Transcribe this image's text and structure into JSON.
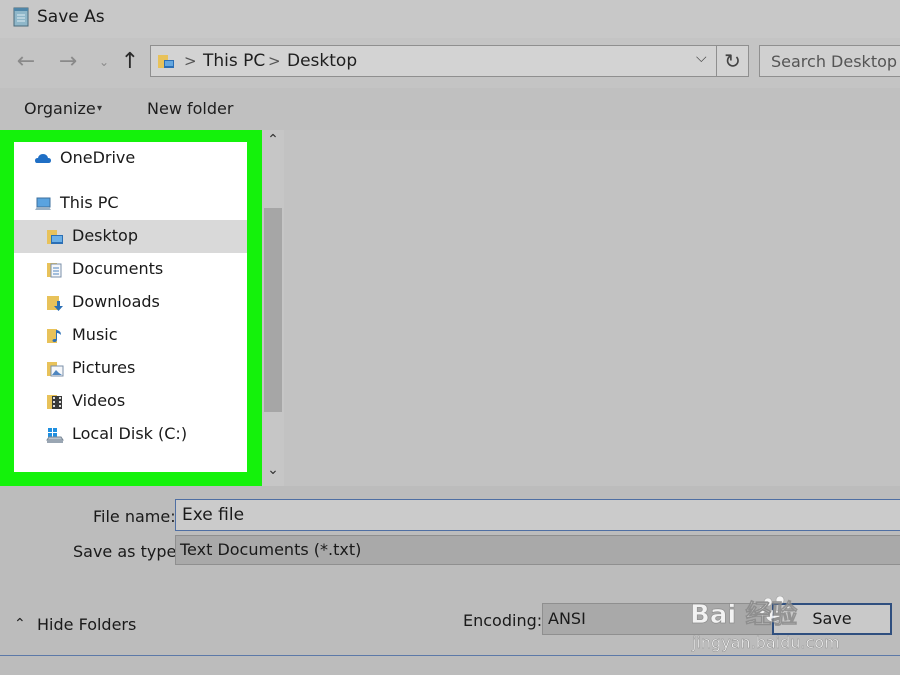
{
  "window": {
    "title": "Save As"
  },
  "nav": {
    "back_glyph": "←",
    "forward_glyph": "→",
    "recent_glyph": "⌄",
    "up_glyph": "↑"
  },
  "address": {
    "crumbs": [
      "This PC",
      "Desktop"
    ],
    "separator": ">",
    "dropdown_glyph": "⌵",
    "refresh_glyph": "↻"
  },
  "search": {
    "placeholder": "Search Desktop"
  },
  "toolbar": {
    "organize_label": "Organize",
    "organize_caret": "▾",
    "new_folder_label": "New folder"
  },
  "sidebar": {
    "items": [
      {
        "label": "OneDrive",
        "icon": "onedrive-cloud-icon"
      },
      {
        "label": "This PC",
        "icon": "computer-icon"
      },
      {
        "label": "Desktop",
        "icon": "desktop-folder-icon",
        "selected": true
      },
      {
        "label": "Documents",
        "icon": "documents-folder-icon"
      },
      {
        "label": "Downloads",
        "icon": "downloads-folder-icon"
      },
      {
        "label": "Music",
        "icon": "music-folder-icon"
      },
      {
        "label": "Pictures",
        "icon": "pictures-folder-icon"
      },
      {
        "label": "Videos",
        "icon": "videos-folder-icon"
      },
      {
        "label": "Local Disk (C:)",
        "icon": "local-disk-icon"
      }
    ],
    "scroll_up_glyph": "⌃",
    "scroll_down_glyph": "⌄"
  },
  "form": {
    "file_name_label": "File name:",
    "file_name_value": "Exe file",
    "save_as_type_label": "Save as type:",
    "save_as_type_value": "Text Documents (*.txt)",
    "hide_folders_glyph": "⌃",
    "hide_folders_label": "Hide Folders",
    "encoding_label": "Encoding:",
    "encoding_value": "ANSI",
    "save_label": "Save"
  },
  "watermark": {
    "text_top": "Bai 经验",
    "text_bottom": "jingyan.baidu.com"
  },
  "colors": {
    "highlight_frame": "#14f20b",
    "accent_border": "#2f4f7f",
    "window_bg": "#bdbdbd"
  }
}
